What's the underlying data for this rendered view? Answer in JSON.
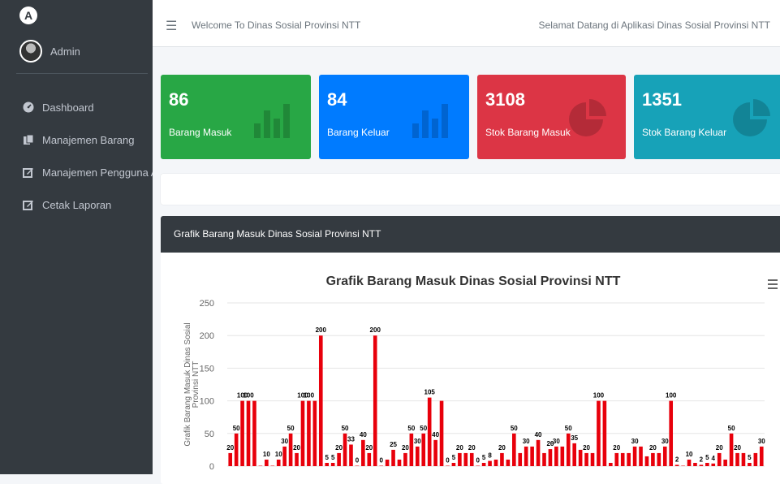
{
  "sidebar": {
    "brand_letter": "A",
    "user_name": "Admin",
    "items": [
      {
        "label": "Dashboard",
        "icon": "dashboard-icon"
      },
      {
        "label": "Manajemen Barang",
        "icon": "copy-icon"
      },
      {
        "label": "Manajemen Pengguna Aplik",
        "icon": "edit-icon"
      },
      {
        "label": "Cetak Laporan",
        "icon": "edit-icon"
      }
    ]
  },
  "topbar": {
    "left_text": "Welcome To Dinas Sosial Provinsi NTT",
    "right_text": "Selamat Datang di Aplikasi Dinas Sosial Provinsi NTT"
  },
  "stats": [
    {
      "value": "86",
      "label": "Barang Masuk",
      "color": "#28a745",
      "icon": "bar-chart-icon"
    },
    {
      "value": "84",
      "label": "Barang Keluar",
      "color": "#007bff",
      "icon": "bar-chart-icon"
    },
    {
      "value": "3108",
      "label": "Stok Barang Masuk",
      "color": "#dc3545",
      "icon": "pie-chart-icon"
    },
    {
      "value": "1351",
      "label": "Stok Barang Keluar",
      "color": "#17a2b8",
      "icon": "pie-chart-icon"
    }
  ],
  "chart_card": {
    "header": "Grafik Barang Masuk Dinas Sosial Provinsi NTT"
  },
  "chart_data": {
    "type": "bar",
    "title": "Grafik Barang Masuk Dinas Sosial Provinsi NTT",
    "ylabel": "Grafik Barang Masuk Dinas Sosial Provinsi NTT",
    "xlabel": "",
    "ylim": [
      0,
      250
    ],
    "yticks": [
      0,
      50,
      100,
      150,
      200,
      250
    ],
    "color": "#e8000b",
    "values": [
      20,
      50,
      100,
      100,
      100,
      0,
      10,
      0,
      10,
      30,
      50,
      20,
      100,
      100,
      100,
      200,
      5,
      5,
      20,
      50,
      33,
      0,
      40,
      20,
      200,
      0,
      10,
      25,
      10,
      20,
      50,
      30,
      50,
      105,
      40,
      100,
      0,
      5,
      20,
      20,
      20,
      0,
      5,
      8,
      10,
      20,
      10,
      50,
      20,
      30,
      30,
      40,
      20,
      26,
      30,
      30,
      50,
      35,
      25,
      20,
      20,
      100,
      100,
      5,
      20,
      20,
      20,
      30,
      30,
      15,
      20,
      20,
      30,
      100,
      2,
      0,
      10,
      5,
      2,
      5,
      4,
      20,
      10,
      50,
      20,
      20,
      5,
      20,
      30
    ],
    "labels": [
      "20",
      "50",
      "100",
      "100",
      null,
      null,
      "10",
      null,
      "10",
      "30",
      "50",
      "20",
      "100",
      "100",
      null,
      "200",
      "5",
      "5",
      "20",
      "50",
      "33",
      "0",
      "40",
      "20",
      "200",
      "0",
      null,
      "25",
      null,
      "20",
      "50",
      "30",
      "50",
      "105",
      "40",
      null,
      "0",
      "5",
      "20",
      null,
      "20",
      "0",
      "5",
      "8",
      null,
      "20",
      null,
      "50",
      null,
      "30",
      null,
      "40",
      null,
      "26",
      "30",
      null,
      "50",
      "35",
      null,
      "20",
      null,
      "100",
      null,
      null,
      "20",
      null,
      null,
      "30",
      null,
      null,
      "20",
      null,
      "30",
      "100",
      "2",
      null,
      "10",
      null,
      "2",
      "5",
      "4",
      "20",
      null,
      "50",
      "20",
      null,
      "5",
      null,
      "30"
    ]
  },
  "menu_icon": "hamburger-icon"
}
